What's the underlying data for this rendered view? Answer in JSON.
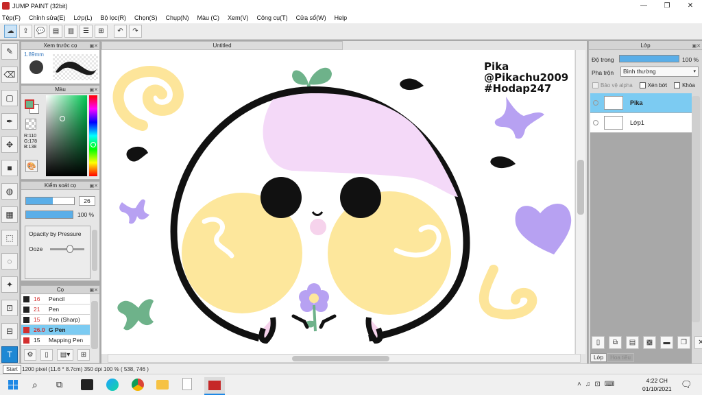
{
  "window": {
    "title": "JUMP PAINT (32bit)",
    "btn_min": "—",
    "btn_max": "❐",
    "btn_close": "✕"
  },
  "menu": [
    "Tệp(F)",
    "Chỉnh sửa(E)",
    "Lớp(L)",
    "Bộ lọc(R)",
    "Chọn(S)",
    "Chụp(N)",
    "Màu (C)",
    "Xem(V)",
    "Công cụ(T)",
    "Cửa sổ(W)",
    "Help"
  ],
  "document": {
    "tab": "Untitled"
  },
  "canvas_text": {
    "line1": "Pika",
    "line2": "@Pikachu2009",
    "line3": "#Hodap247"
  },
  "brush_preview": {
    "title": "Xem trước cọ",
    "size": "1.89mm"
  },
  "color_panel": {
    "title": "Màu",
    "r": "R:110",
    "g": "G:178",
    "b": "B:138",
    "current_color": "#6eb28a"
  },
  "brush_control": {
    "title": "Kiểm soát cọ",
    "size_value": "26",
    "opacity_value": "100 %",
    "opacity_pressure": "Opacity by Pressure",
    "ooze": "Ooze",
    "size_fill": 0.55,
    "opacity_fill": 1.0
  },
  "brush_list": {
    "title": "Cọ",
    "items": [
      {
        "size": "16",
        "name": "Pencil",
        "color": "#222222"
      },
      {
        "size": "21",
        "name": "Pen",
        "color": "#222222"
      },
      {
        "size": "15",
        "name": "Pen (Sharp)",
        "color": "#222222"
      },
      {
        "size": "26.0",
        "name": "G Pen",
        "color": "#d32f2f",
        "selected": true
      },
      {
        "size": "15",
        "name": "Mapping Pen",
        "color": "#d32f2f"
      }
    ]
  },
  "layer_panel": {
    "title": "Lớp",
    "opacity_label": "Độ trong",
    "opacity_value": "100 %",
    "blend_label": "Pha trộn",
    "blend_value": "Bình thường",
    "protect_alpha": "Bảo vệ alpha",
    "clip": "Xén bớt",
    "lock": "Khóa",
    "layers": [
      {
        "name": "Pika",
        "selected": true
      },
      {
        "name": "Lớp1",
        "selected": false
      }
    ],
    "tabs": [
      "Lớp",
      "Hoa tiêu"
    ]
  },
  "status": {
    "start_tooltip": "Start",
    "info": "1200 pixel  (11.6 * 8.7cm)  350 dpi  100 %  ( 538, 746 )"
  },
  "taskbar": {
    "time": "4:22 CH",
    "date": "01/10/2021"
  }
}
